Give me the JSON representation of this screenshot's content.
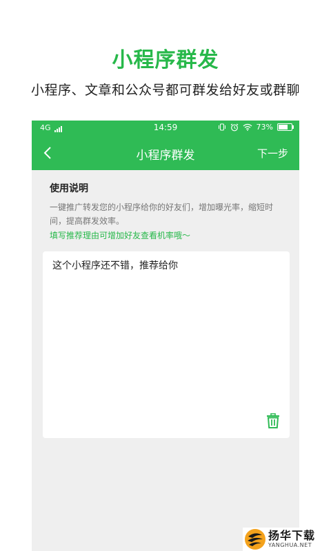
{
  "promo": {
    "title": "小程序群发",
    "subtitle": "小程序、文章和公众号都可群发给好友或群聊"
  },
  "statusbar": {
    "network": "4G",
    "time": "14:59",
    "battery": "73%",
    "battery_level": 0.73
  },
  "navbar": {
    "back_icon": "chevron-left-icon",
    "title": "小程序群发",
    "next_label": "下一步"
  },
  "instructions": {
    "heading": "使用说明",
    "body": "一键推广转发您的小程序给你的好友们，增加曝光率，缩短时间，提高群发效率。",
    "tip": "填写推荐理由可增加好友查看机率哦～"
  },
  "message": {
    "text": "这个小程序还不错，推荐给你",
    "delete_icon": "trash-icon"
  },
  "watermark": {
    "cn": "扬华下载",
    "en": "YANGHUA.NET"
  },
  "colors": {
    "accent": "#2fbb55",
    "tip_green": "#27b84a"
  }
}
